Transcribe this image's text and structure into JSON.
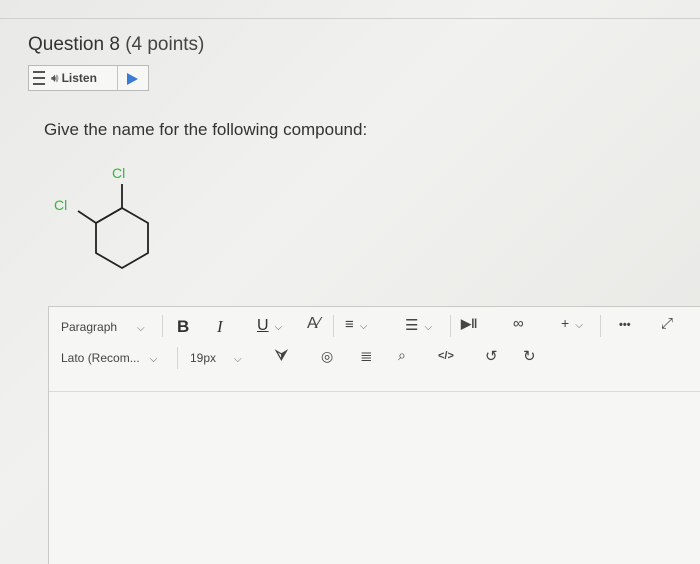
{
  "question": {
    "title": "Question 8",
    "points": "(4 points)",
    "prompt": "Give the name for the following compound:"
  },
  "listen": {
    "label": "Listen",
    "icon_menu": "menu-icon",
    "icon_speaker": "speaker-icon",
    "icon_play": "play-icon"
  },
  "molecule": {
    "substituents": [
      "Cl",
      "Cl"
    ]
  },
  "editor": {
    "toolbar": {
      "paragraph": "Paragraph",
      "font": "Lato (Recom...",
      "size": "19px",
      "bold": "B",
      "italic": "I",
      "underline": "U",
      "insert": "+",
      "more": "•••"
    },
    "content": ""
  },
  "colors": {
    "accent": "#3a7bd5",
    "chlorine": "#3cb043",
    "text": "#333333"
  }
}
